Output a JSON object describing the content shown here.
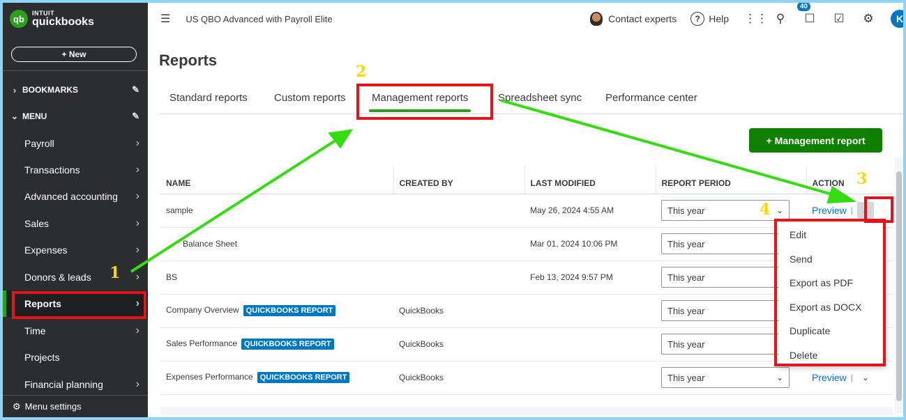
{
  "logo": {
    "line1": "INTUIT",
    "line2": "quickbooks",
    "mark": "qb"
  },
  "sidebar": {
    "new_label": "+ New",
    "bookmarks_label": "BOOKMARKS",
    "menu_label": "MENU",
    "items": [
      {
        "label": "Payroll",
        "arrow": true
      },
      {
        "label": "Transactions",
        "arrow": true
      },
      {
        "label": "Advanced accounting",
        "arrow": true
      },
      {
        "label": "Sales",
        "arrow": true
      },
      {
        "label": "Expenses",
        "arrow": true
      },
      {
        "label": "Donors & leads",
        "arrow": true
      },
      {
        "label": "Reports",
        "arrow": true,
        "active": true
      },
      {
        "label": "Time",
        "arrow": true
      },
      {
        "label": "Projects",
        "arrow": false
      },
      {
        "label": "Financial planning",
        "arrow": true
      }
    ],
    "menu_settings_label": "Menu settings"
  },
  "topbar": {
    "company_name": "US QBO Advanced with Payroll Elite",
    "contact_label": "Contact experts",
    "help_label": "Help",
    "notification_count": "40",
    "user_initial": "K"
  },
  "page": {
    "title": "Reports",
    "tabs": [
      "Standard reports",
      "Custom reports",
      "Management reports",
      "Spreadsheet sync",
      "Performance center"
    ],
    "active_tab": "Management reports",
    "new_report_button": "+ Management report"
  },
  "table": {
    "columns": [
      "NAME",
      "CREATED BY",
      "LAST MODIFIED",
      "REPORT PERIOD",
      "ACTION"
    ],
    "badge_text": "QUICKBOOKS REPORT",
    "rows": [
      {
        "name": "sample",
        "badge": false,
        "created_by": "",
        "last_modified": "May 26, 2024 4:55 AM",
        "period": "This year",
        "action": "Preview"
      },
      {
        "name": "Balance Sheet",
        "badge": false,
        "created_by": "",
        "last_modified": "Mar 01, 2024 10:06 PM",
        "period": "This year",
        "action": ""
      },
      {
        "name": "BS",
        "badge": false,
        "created_by": "",
        "last_modified": "Feb 13, 2024 9:57 PM",
        "period": "This year",
        "action": ""
      },
      {
        "name": "Company Overview",
        "badge": true,
        "created_by": "QuickBooks",
        "last_modified": "",
        "period": "This year",
        "action": ""
      },
      {
        "name": "Sales Performance",
        "badge": true,
        "created_by": "QuickBooks",
        "last_modified": "",
        "period": "This year",
        "action": ""
      },
      {
        "name": "Expenses Performance",
        "badge": true,
        "created_by": "QuickBooks",
        "last_modified": "",
        "period": "This year",
        "action": "Preview"
      }
    ]
  },
  "action_menu": {
    "items": [
      "Edit",
      "Send",
      "Export as PDF",
      "Export as DOCX",
      "Duplicate",
      "Delete"
    ]
  },
  "annotations": {
    "labels": [
      "1",
      "2",
      "3",
      "4"
    ],
    "box_color": "#e1151c",
    "arrow_color": "#33dd11",
    "number_color": "#ffd700"
  },
  "colors": {
    "brand_green": "#2ca01c",
    "button_green": "#108000",
    "link_blue": "#0077c5",
    "sidebar_bg": "#2b2d30"
  }
}
